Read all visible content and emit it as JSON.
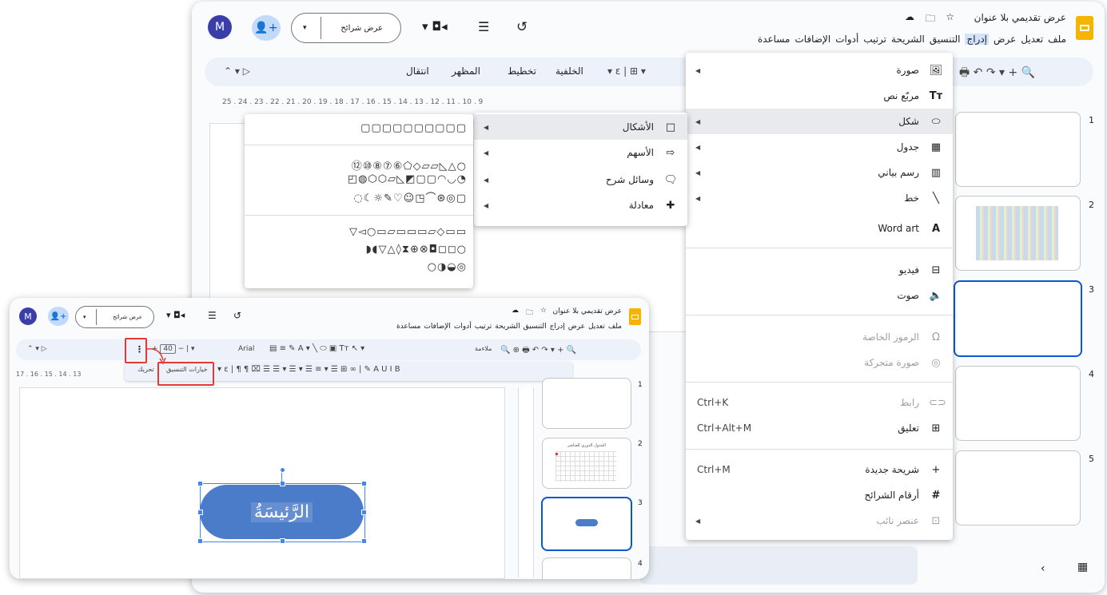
{
  "back": {
    "doc_title": "عرض تقديمي بلا عنوان",
    "menubar": [
      "ملف",
      "تعديل",
      "عرض",
      "إدراج",
      "التنسيق",
      "الشريحة",
      "ترتيب",
      "أدوات",
      "الإضافات",
      "مساعدة"
    ],
    "avatar_letter": "M",
    "slideshow_label": "عرض شرائح",
    "toolbar": [
      "انتقال",
      "المظهر",
      "تخطيط",
      "الخلفية"
    ],
    "ruler": "25 . 24 . 23 . 22 . 21 . 20 . 19 . 18 . 17 . 16 . 15 . 14 . 13 . 12 . 11 . 10 . 9",
    "thumb_numbers": [
      "1",
      "2",
      "3",
      "4",
      "5"
    ]
  },
  "insert_menu": {
    "items": [
      {
        "label": "صورة",
        "icon": "image-icon",
        "submenu": true
      },
      {
        "label": "مربّع نص",
        "icon": "textbox-icon",
        "submenu": false
      },
      {
        "label": "شكل",
        "icon": "shape-icon",
        "submenu": true
      },
      {
        "label": "جدول",
        "icon": "table-icon",
        "submenu": true
      },
      {
        "label": "رسم بياني",
        "icon": "chart-icon",
        "submenu": true
      },
      {
        "label": "خط",
        "icon": "line-icon",
        "submenu": true
      },
      {
        "label": "Word art",
        "icon": "wordart-icon",
        "submenu": false
      },
      {
        "label": "فيديو",
        "icon": "video-icon",
        "submenu": false
      },
      {
        "label": "صوت",
        "icon": "audio-icon",
        "submenu": false
      },
      {
        "label": "الرموز الخاصة",
        "icon": "special-chars-icon",
        "disabled": true
      },
      {
        "label": "صورة متحركة",
        "icon": "gif-icon",
        "disabled": true
      },
      {
        "label": "رابط",
        "icon": "link-icon",
        "shortcut": "Ctrl+K",
        "disabled": true
      },
      {
        "label": "تعليق",
        "icon": "comment-icon",
        "shortcut": "Ctrl+Alt+M"
      },
      {
        "label": "شريحة جديدة",
        "icon": "plus-icon",
        "shortcut": "Ctrl+M"
      },
      {
        "label": "أرقام الشرائح",
        "icon": "hash-icon"
      },
      {
        "label": "عنصر نائب",
        "icon": "placeholder-icon",
        "disabled": true,
        "submenu": true
      }
    ]
  },
  "shape_menu": {
    "items": [
      "الأشكال",
      "الأسهم",
      "وسائل شرح",
      "معادلة"
    ]
  },
  "shapes_grid": {
    "row1": "▢▢▢▢▢▢▢▢▢▢",
    "row2": "⑫⑩⑧⑦⑥⬠◇▱▱◺△○",
    "row3": "◰◍⬡⬡▱◺◩▢▢◠◡◔",
    "row4": "◌☾☼✎♡☺◳⌒⊛◎▢",
    "row5": "▽◅○▭▱▭▭▭▱◇▭▭",
    "row6": "◗◖▽△◊⧗⊕⊗◘◻◻○",
    "row7": "○◑◒◎"
  },
  "front": {
    "doc_title": "عرض تقديمي بلا عنوان",
    "menubar": [
      "ملف",
      "تعديل",
      "عرض",
      "إدراج",
      "التنسيق",
      "الشريحة",
      "ترتيب",
      "أدوات",
      "الإضافات",
      "مساعدة"
    ],
    "avatar_letter": "M",
    "slideshow_label": "عرض شرائح",
    "font_name": "Arial",
    "font_size": "40",
    "fit_label": "ملاءمة",
    "format_options_label": "خيارات التنسيق",
    "animate_label": "تحريك",
    "ruler": "17 . 16 . 15 . 14 . 13",
    "thumb_numbers": [
      "1",
      "2",
      "3",
      "4"
    ],
    "thumb2_title": "الجدول الدوري للعناصر",
    "slide_button_text": "الرَّئيسَةُ"
  },
  "colors": {
    "accent": "#0b57d0",
    "shape_fill": "#4a7cc9",
    "red_highlight": "#e53935",
    "avatar": "#3b3ea8",
    "slides_logo": "#f4b400"
  }
}
